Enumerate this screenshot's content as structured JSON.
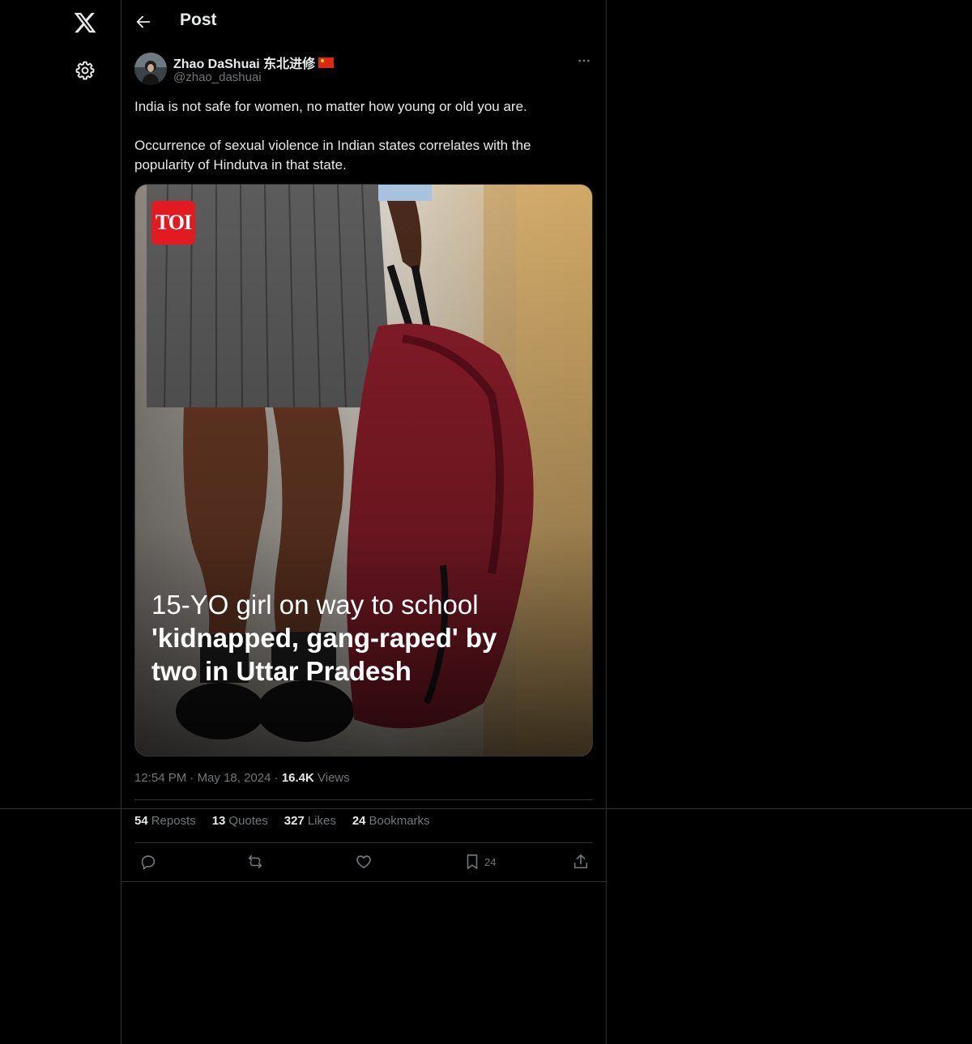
{
  "nav": {
    "logo_icon": "x-logo-icon",
    "settings_icon": "gear-icon"
  },
  "header": {
    "title": "Post",
    "back_icon": "arrow-left-icon"
  },
  "author": {
    "name": "Zhao DaShuai 东北进修",
    "flag_icon": "china-flag-icon",
    "handle": "@zhao_dashuai"
  },
  "tweet": {
    "paragraphs": [
      "India is not safe for women, no matter how young or old you are.",
      "Occurrence of sexual violence in Indian states correlates with the popularity of Hindutva in that state."
    ]
  },
  "media": {
    "badge": "TOI",
    "headline_line1": "15-YO girl on way to school",
    "headline_line2": "'kidnapped, gang-raped' by",
    "headline_line3": "two in Uttar Pradesh"
  },
  "meta": {
    "time": "12:54 PM",
    "dot": "·",
    "date": "May 18, 2024",
    "views_count": "16.4K",
    "views_label": "Views"
  },
  "stats": {
    "reposts_count": "54",
    "reposts_label": "Reposts",
    "quotes_count": "13",
    "quotes_label": "Quotes",
    "likes_count": "327",
    "likes_label": "Likes",
    "bookmarks_count": "24",
    "bookmarks_label": "Bookmarks"
  },
  "actions": {
    "reply_icon": "reply-icon",
    "repost_icon": "repost-icon",
    "like_icon": "heart-icon",
    "bookmark_icon": "bookmark-icon",
    "bookmark_count": "24",
    "share_icon": "share-icon"
  },
  "colors": {
    "background": "#000000",
    "text": "#e7e9ea",
    "muted": "#71767b",
    "border": "#2f3336",
    "toi_red": "#e21b22"
  }
}
